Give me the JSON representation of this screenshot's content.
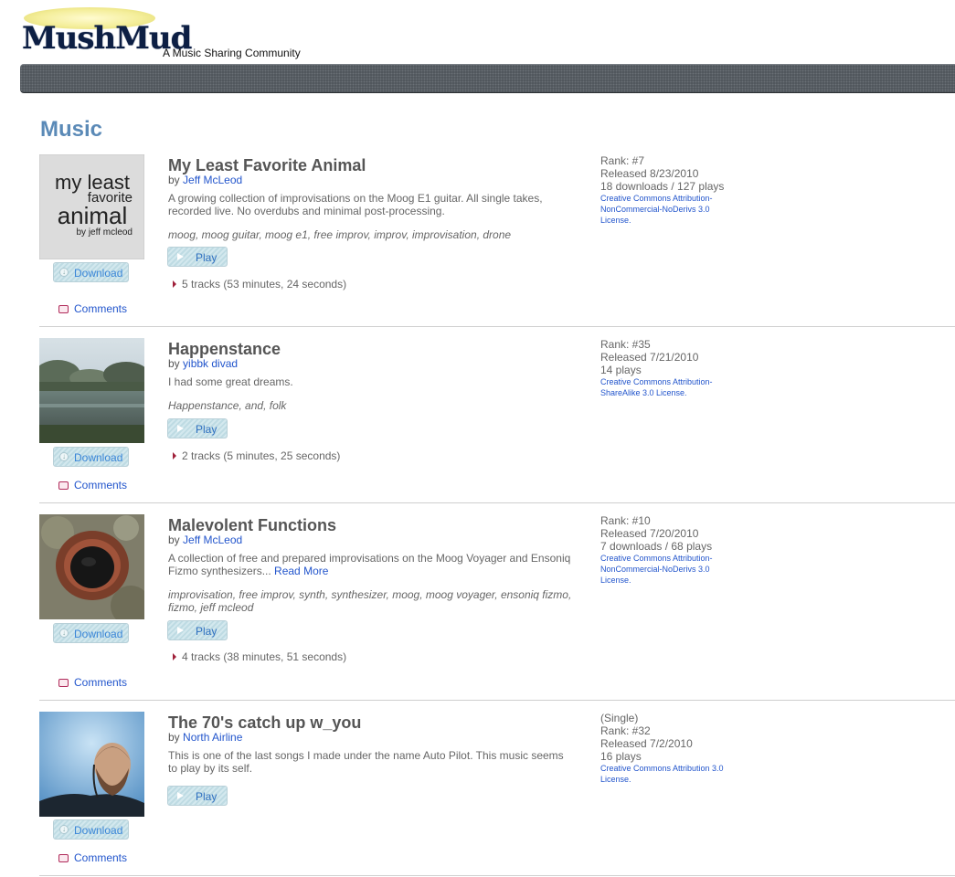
{
  "site": {
    "logo_text": "MushMud",
    "tagline": "A Music Sharing Community"
  },
  "page": {
    "title": "Music"
  },
  "labels": {
    "download": "Download",
    "comments": "Comments",
    "play": "Play",
    "by": "by"
  },
  "albums": [
    {
      "title": "My Least Favorite Animal",
      "artist": "Jeff McLeod",
      "description": "A growing collection of improvisations on the Moog E1 guitar. All single takes, recorded live. No overdubs and minimal post-processing.",
      "read_more": "",
      "tags": "moog, moog guitar, moog e1, free improv, improv, improvisation, drone",
      "tracks": "5 tracks (53 minutes, 24 seconds)",
      "single": "",
      "rank": "Rank: #7",
      "released": "Released 8/23/2010",
      "stats": "18 downloads / 127 plays",
      "license": "Creative Commons Attribution-NonCommercial-NoDerivs 3.0 License.",
      "cover_text": [
        "my least",
        "favorite",
        "animal",
        "by jeff mcleod"
      ]
    },
    {
      "title": "Happenstance",
      "artist": "yibbk divad",
      "description": "I had some great dreams.",
      "read_more": "",
      "tags": "Happenstance, and, folk",
      "tracks": "2 tracks (5 minutes, 25 seconds)",
      "single": "",
      "rank": "Rank: #35",
      "released": "Released 7/21/2010",
      "stats": "14 plays",
      "license": "Creative Commons Attribution-ShareAlike 3.0 License."
    },
    {
      "title": "Malevolent Functions",
      "artist": "Jeff McLeod",
      "description": "A collection of free and prepared improvisations on the Moog Voyager and Ensoniq Fizmo synthesizers...",
      "read_more": "Read More",
      "tags": "improvisation, free improv, synth, synthesizer, moog, moog voyager, ensoniq fizmo, fizmo, jeff mcleod",
      "tracks": "4 tracks (38 minutes, 51 seconds)",
      "single": "",
      "rank": "Rank: #10",
      "released": "Released 7/20/2010",
      "stats": "7 downloads / 68 plays",
      "license": "Creative Commons Attribution-NonCommercial-NoDerivs 3.0 License."
    },
    {
      "title": "The 70's catch up w_you",
      "artist": "North Airline",
      "description": "This is one of the last songs I made under the name Auto Pilot. This music seems to play by its self.",
      "read_more": "",
      "tags": "",
      "tracks": "",
      "single": "(Single)",
      "rank": "Rank: #32",
      "released": "Released 7/2/2010",
      "stats": "16 plays",
      "license": "Creative Commons Attribution 3.0 License."
    }
  ]
}
